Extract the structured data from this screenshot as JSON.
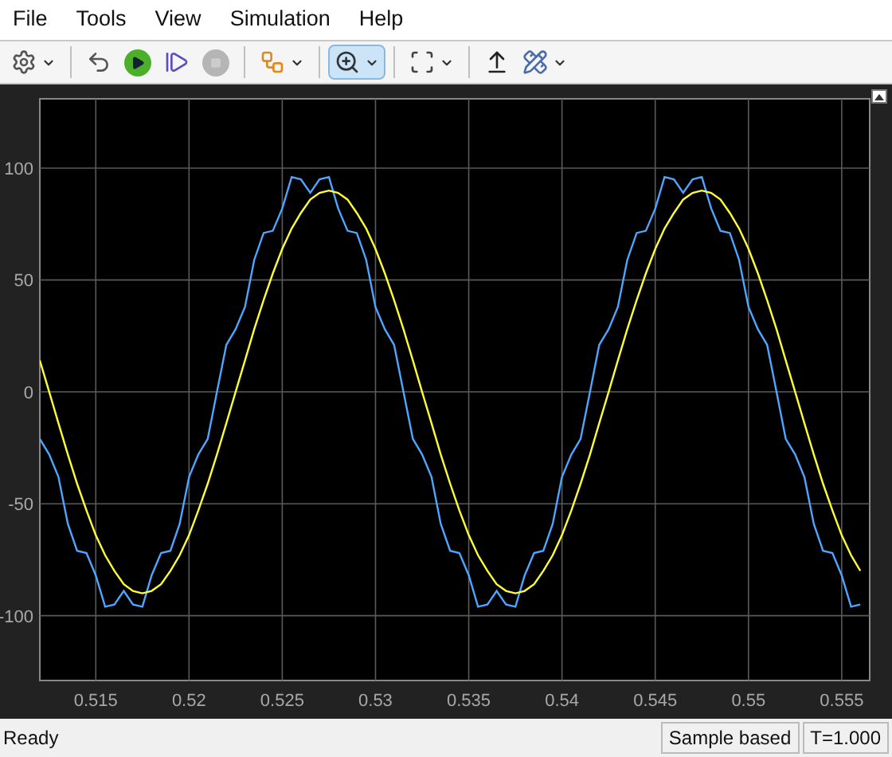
{
  "menu": [
    "File",
    "Tools",
    "View",
    "Simulation",
    "Help"
  ],
  "toolbar": [
    {
      "selected": false,
      "disabled": false,
      "has_menu": true
    },
    {
      "selected": false,
      "disabled": false,
      "has_menu": false
    },
    {
      "selected": false,
      "disabled": false,
      "has_menu": false
    },
    {
      "selected": false,
      "disabled": false,
      "has_menu": false
    },
    {
      "selected": false,
      "disabled": true,
      "has_menu": false
    },
    {
      "selected": false,
      "disabled": false,
      "has_menu": true
    },
    {
      "selected": true,
      "disabled": false,
      "has_menu": true
    },
    {
      "selected": false,
      "disabled": false,
      "has_menu": true
    },
    {
      "selected": false,
      "disabled": false,
      "has_menu": false
    },
    {
      "selected": false,
      "disabled": false,
      "has_menu": true
    }
  ],
  "scope": {
    "chart_data": {
      "type": "line",
      "grid": true,
      "xlim": [
        0.512,
        0.5565
      ],
      "ylim": [
        -129,
        131
      ],
      "xticks": [
        {
          "value": 0.515,
          "label": "0.515"
        },
        {
          "value": 0.52,
          "label": "0.52"
        },
        {
          "value": 0.525,
          "label": "0.525"
        },
        {
          "value": 0.53,
          "label": "0.53"
        },
        {
          "value": 0.535,
          "label": "0.535"
        },
        {
          "value": 0.54,
          "label": "0.54"
        },
        {
          "value": 0.545,
          "label": "0.545"
        },
        {
          "value": 0.55,
          "label": "0.55"
        },
        {
          "value": 0.555,
          "label": "0.555"
        }
      ],
      "yticks": [
        {
          "value": -100,
          "label": "-100"
        },
        {
          "value": -50,
          "label": "-50"
        },
        {
          "value": 0,
          "label": "0"
        },
        {
          "value": 50,
          "label": "50"
        },
        {
          "value": 100,
          "label": "100"
        }
      ],
      "x": [
        0.512,
        0.5125,
        0.513,
        0.5135,
        0.514,
        0.5145,
        0.515,
        0.5155,
        0.516,
        0.5165,
        0.517,
        0.5175,
        0.518,
        0.5185,
        0.519,
        0.5195,
        0.52,
        0.5205,
        0.521,
        0.5215,
        0.522,
        0.5225,
        0.523,
        0.5235,
        0.524,
        0.5245,
        0.525,
        0.5255,
        0.526,
        0.5265,
        0.527,
        0.5275,
        0.528,
        0.5285,
        0.529,
        0.5295,
        0.53,
        0.5305,
        0.531,
        0.5315,
        0.532,
        0.5325,
        0.533,
        0.5335,
        0.534,
        0.5345,
        0.535,
        0.5355,
        0.536,
        0.5365,
        0.537,
        0.5375,
        0.538,
        0.5385,
        0.539,
        0.5395,
        0.54,
        0.5405,
        0.541,
        0.5415,
        0.542,
        0.5425,
        0.543,
        0.5435,
        0.544,
        0.5445,
        0.545,
        0.5455,
        0.546,
        0.5465,
        0.547,
        0.5475,
        0.548,
        0.5485,
        0.549,
        0.5495,
        0.55,
        0.5505,
        0.551,
        0.5515,
        0.552,
        0.5525,
        0.553,
        0.5535,
        0.554,
        0.5545,
        0.555,
        0.5555,
        0.556
      ],
      "series": [
        {
          "color": "#4da6ff",
          "values": [
            -21,
            -28,
            -38,
            -59,
            -71,
            -72,
            -82,
            -96,
            -95,
            -89,
            -95,
            -96,
            -82,
            -72,
            -71,
            -59,
            -38,
            -28,
            -21,
            0,
            21,
            28,
            38,
            59,
            71,
            72,
            82,
            96,
            95,
            89,
            95,
            96,
            82,
            72,
            71,
            59,
            38,
            28,
            21,
            0,
            -21,
            -28,
            -38,
            -59,
            -71,
            -72,
            -82,
            -96,
            -95,
            -89,
            -95,
            -96,
            -82,
            -72,
            -71,
            -59,
            -38,
            -28,
            -21,
            0,
            21,
            28,
            38,
            59,
            71,
            72,
            82,
            96,
            95,
            89,
            95,
            96,
            82,
            72,
            71,
            59,
            38,
            28,
            21,
            0,
            -21,
            -28,
            -38,
            -59,
            -71,
            -72,
            -82,
            -96,
            -95
          ]
        },
        {
          "color": "#ffff33",
          "values": [
            14,
            0,
            -14,
            -28,
            -41,
            -53,
            -64,
            -73,
            -80,
            -86,
            -89,
            -90,
            -89,
            -86,
            -80,
            -73,
            -64,
            -53,
            -41,
            -28,
            -14,
            0,
            14,
            28,
            41,
            53,
            64,
            73,
            80,
            86,
            89,
            90,
            89,
            86,
            80,
            73,
            64,
            53,
            41,
            28,
            14,
            0,
            -14,
            -28,
            -41,
            -53,
            -64,
            -73,
            -80,
            -86,
            -89,
            -90,
            -89,
            -86,
            -80,
            -73,
            -64,
            -53,
            -41,
            -28,
            -14,
            0,
            14,
            28,
            41,
            53,
            64,
            73,
            80,
            86,
            89,
            90,
            89,
            86,
            80,
            73,
            64,
            53,
            41,
            28,
            14,
            0,
            -14,
            -28,
            -41,
            -53,
            -64,
            -73,
            -80
          ]
        }
      ]
    }
  },
  "status_bar": {
    "text": "Ready",
    "mode": "Sample based",
    "time": "T=1.000"
  }
}
